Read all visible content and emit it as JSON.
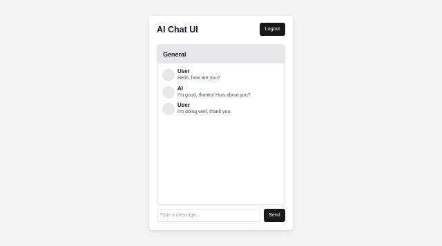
{
  "app": {
    "title": "AI Chat UI",
    "logout_label": "Logout"
  },
  "channel": {
    "name": "General"
  },
  "messages": [
    {
      "sender": "User",
      "text": "Hello, how are you?"
    },
    {
      "sender": "AI",
      "text": "I'm good, thanks! How about you?"
    },
    {
      "sender": "User",
      "text": "I'm doing well, thank you."
    }
  ],
  "composer": {
    "placeholder": "Type a message...",
    "value": "",
    "send_label": "Send"
  },
  "colors": {
    "page_background": "#f3f4f6",
    "button": "#18181b",
    "header": "#e5e7eb",
    "avatar": "#e5e7eb"
  }
}
